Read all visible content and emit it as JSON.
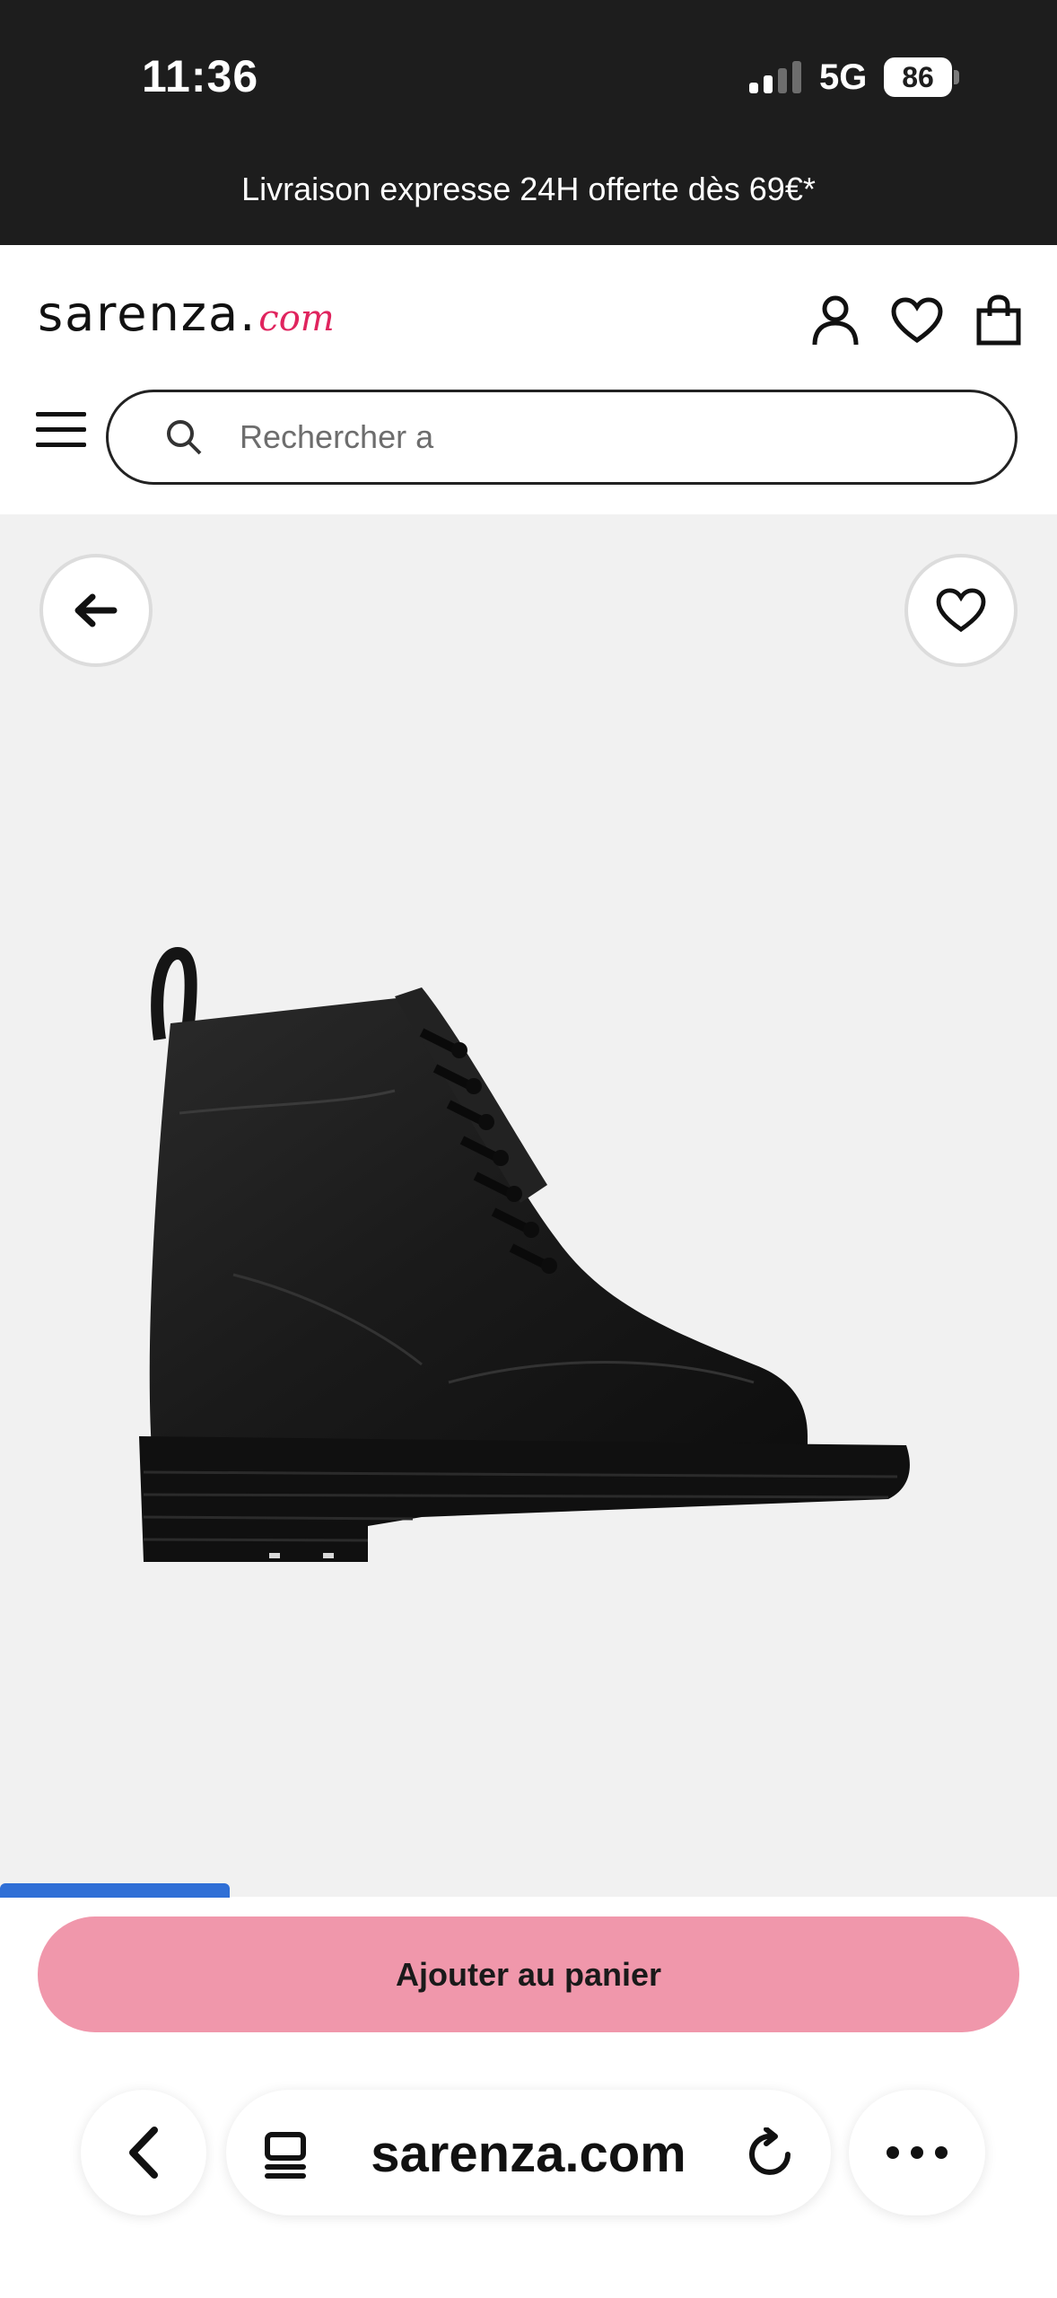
{
  "status_bar": {
    "time": "11:36",
    "network": "5G",
    "battery": "86"
  },
  "promo": {
    "text": "Livraison expresse 24H offerte dès 69€*"
  },
  "header": {
    "logo_main": "sarenza.",
    "logo_com": "com",
    "icons": [
      "user-icon",
      "heart-icon",
      "bag-icon"
    ]
  },
  "search": {
    "placeholder": "Rechercher a"
  },
  "product": {
    "icons": [
      "back-arrow-icon",
      "wishlist-heart-icon"
    ]
  },
  "cta": {
    "label": "Ajouter au panier"
  },
  "browser": {
    "host": "sarenza.com"
  },
  "colors": {
    "cta": "#f097ab",
    "brand_accent": "#e0245e",
    "top_bar": "#1d1d1d",
    "gallery_bg": "#f1f1f1",
    "tab_indicator": "#2f6fd6"
  }
}
